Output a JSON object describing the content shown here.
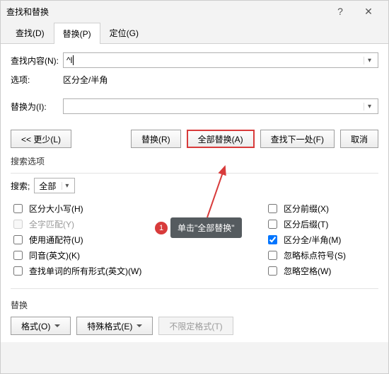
{
  "title": "查找和替换",
  "tabs": {
    "find": "查找(D)",
    "replace": "替换(P)",
    "goto": "定位(G)"
  },
  "fields": {
    "find_label": "查找内容(N):",
    "find_value": "^l",
    "opts_label": "选项:",
    "opts_value": "区分全/半角",
    "replace_label": "替换为(I):",
    "replace_value": ""
  },
  "buttons": {
    "less": "<< 更少(L)",
    "replace": "替换(R)",
    "replace_all": "全部替换(A)",
    "find_next": "查找下一处(F)",
    "cancel": "取消"
  },
  "search": {
    "section": "搜索选项",
    "label": "搜索;",
    "scope": "全部",
    "left": {
      "case": "区分大小写(H)",
      "whole": "全字匹配(Y)",
      "wildcard": "使用通配符(U)",
      "homophone": "同音(英文)(K)",
      "allforms": "查找单词的所有形式(英文)(W)"
    },
    "right": {
      "prefix": "区分前缀(X)",
      "suffix": "区分后缀(T)",
      "width": "区分全/半角(M)",
      "punct": "忽略标点符号(S)",
      "space": "忽略空格(W)"
    }
  },
  "replace_section": {
    "title": "替换",
    "format": "格式(O)",
    "special": "特殊格式(E)",
    "noformat": "不限定格式(T)"
  },
  "annotation": {
    "num": "1",
    "text": "单击\"全部替换\""
  }
}
